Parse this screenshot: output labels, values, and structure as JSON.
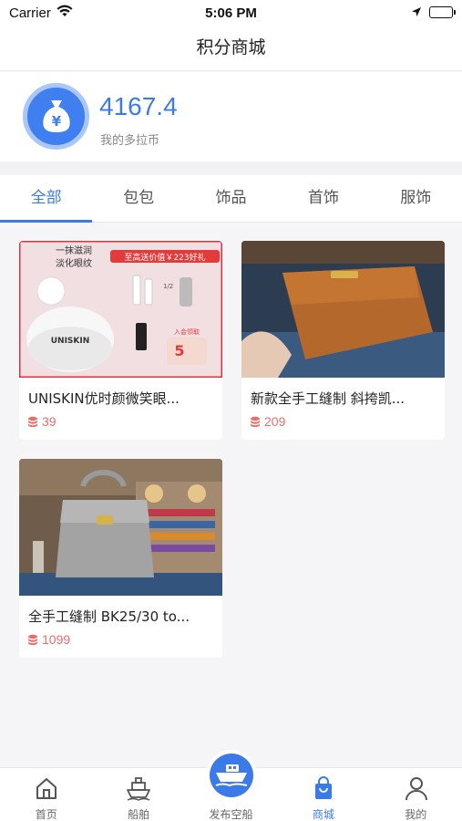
{
  "status_bar": {
    "carrier": "Carrier",
    "time": "5:06 PM"
  },
  "nav": {
    "title": "积分商城"
  },
  "balance": {
    "amount": "4167.4",
    "label": "我的多拉币",
    "coin_symbol": "¥"
  },
  "tabs": [
    {
      "label": "全部",
      "active": true
    },
    {
      "label": "包包",
      "active": false
    },
    {
      "label": "饰品",
      "active": false
    },
    {
      "label": "首饰",
      "active": false
    },
    {
      "label": "服饰",
      "active": false
    }
  ],
  "products": [
    {
      "name": "UNISKIN优时颜微笑眼...",
      "price": "39",
      "image": "skincare-product-photo",
      "image_texts": {
        "headline_1": "一抹滋润",
        "headline_2": "淡化眼纹",
        "banner": "至高送价值￥223好礼",
        "jar_brand": "UNISKIN",
        "small_1": "1/2",
        "badge_top": "入会领取",
        "badge_num": "5"
      }
    },
    {
      "name": "新款全手工缝制 斜挎凯...",
      "price": "209",
      "image": "tan-leather-clutch-photo"
    },
    {
      "name": "全手工缝制 BK25/30 to...",
      "price": "1099",
      "image": "grey-leather-handbag-photo"
    }
  ],
  "tab_bar": [
    {
      "label": "首页",
      "icon": "home-icon",
      "active": false
    },
    {
      "label": "船舶",
      "icon": "ship-icon",
      "active": false
    },
    {
      "label": "发布空船",
      "icon": "publish-ship-icon",
      "active": false
    },
    {
      "label": "商城",
      "icon": "shopping-bag-icon",
      "active": true
    },
    {
      "label": "我的",
      "icon": "profile-icon",
      "active": false
    }
  ],
  "colors": {
    "accent": "#3b7be8",
    "price": "#f06a6a"
  }
}
